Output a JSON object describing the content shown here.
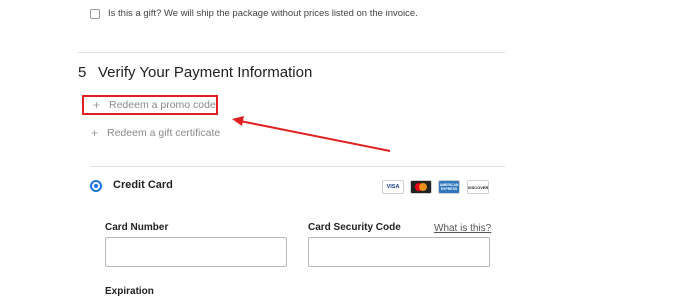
{
  "gift": {
    "label": "Is this a gift? We will ship the package without prices listed on the invoice.",
    "checked": false
  },
  "payment_section": {
    "step_number": "5",
    "title": "Verify Your Payment Information",
    "promo_link": {
      "icon": "+",
      "label": "Redeem a promo code"
    },
    "gift_cert_link": {
      "icon": "+",
      "label": "Redeem a gift certificate"
    }
  },
  "credit_card": {
    "label": "Credit Card",
    "selected": true,
    "logos": [
      {
        "name": "visa-logo",
        "text": "VISA",
        "color": "#1a3b8f"
      },
      {
        "name": "mastercard-logo",
        "text": "",
        "color": "#eb001b"
      },
      {
        "name": "amex-logo",
        "text": "AMERICAN EXPRESS",
        "color": "#2e77bc"
      },
      {
        "name": "discover-logo",
        "text": "DISCOVER",
        "color": "#f58220"
      }
    ],
    "card_number": {
      "label": "Card Number",
      "value": ""
    },
    "security_code": {
      "label": "Card Security Code",
      "value": "",
      "help_link": "What is this?"
    },
    "expiration": {
      "label": "Expiration"
    }
  },
  "colors": {
    "annotation": "#e02020",
    "radio_accent": "#1a73e8"
  }
}
